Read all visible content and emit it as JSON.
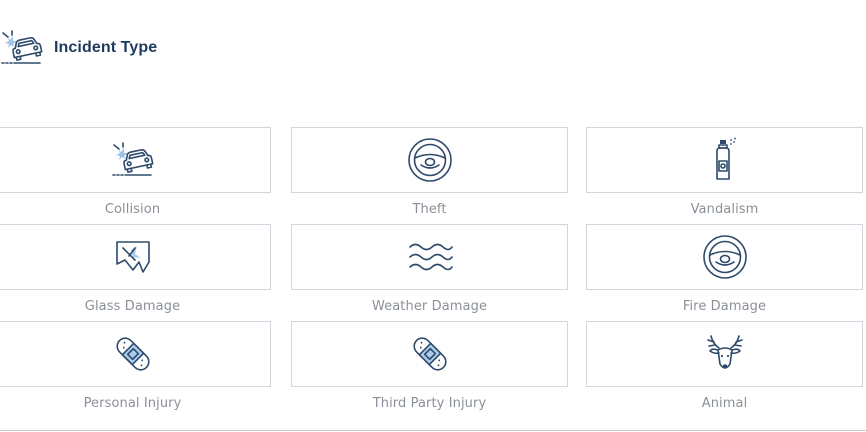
{
  "header": {
    "title": "Incident Type",
    "icon": "car-collision-icon"
  },
  "options": [
    {
      "label": "Collision",
      "icon": "car-collision-icon"
    },
    {
      "label": "Theft",
      "icon": "steering-wheel-icon"
    },
    {
      "label": "Vandalism",
      "icon": "spray-can-icon"
    },
    {
      "label": "Glass Damage",
      "icon": "broken-glass-icon"
    },
    {
      "label": "Weather Damage",
      "icon": "waves-icon"
    },
    {
      "label": "Fire Damage",
      "icon": "steering-wheel-icon"
    },
    {
      "label": "Personal Injury",
      "icon": "bandage-icon"
    },
    {
      "label": "Third Party Injury",
      "icon": "bandage-icon"
    },
    {
      "label": "Animal",
      "icon": "deer-icon"
    }
  ],
  "colors": {
    "icon_ink": "#2e4a6b",
    "icon_accent": "#9ec3ea",
    "title": "#1f3a5f",
    "label": "#8a9099",
    "tile_border": "#cfd6de"
  }
}
